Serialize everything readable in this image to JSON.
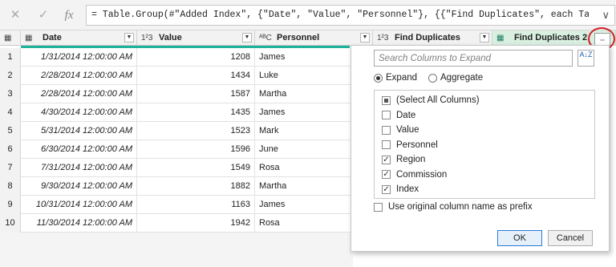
{
  "formula_bar": {
    "cancel_icon": "✕",
    "confirm_icon": "✓",
    "fx_label": "fx",
    "formula": "= Table.Group(#\"Added Index\", {\"Date\", \"Value\", \"Personnel\"}, {{\"Find Duplicates\", each Table.RowCount",
    "expand_icon": "chevron-down-icon"
  },
  "columns": [
    {
      "type_icon": "▦",
      "name": "Date"
    },
    {
      "type_icon": "1²3",
      "name": "Value"
    },
    {
      "type_icon": "ᴬᴮC",
      "name": "Personnel"
    },
    {
      "type_icon": "1²3",
      "name": "Find Duplicates"
    },
    {
      "type_icon": "▦",
      "name": "Find Duplicates 2"
    }
  ],
  "table_menu_icon": "▦",
  "rows": [
    {
      "n": "1",
      "date": "1/31/2014 12:00:00 AM",
      "value": "1208",
      "person": "James"
    },
    {
      "n": "2",
      "date": "2/28/2014 12:00:00 AM",
      "value": "1434",
      "person": "Luke"
    },
    {
      "n": "3",
      "date": "2/28/2014 12:00:00 AM",
      "value": "1587",
      "person": "Martha"
    },
    {
      "n": "4",
      "date": "4/30/2014 12:00:00 AM",
      "value": "1435",
      "person": "James"
    },
    {
      "n": "5",
      "date": "5/31/2014 12:00:00 AM",
      "value": "1523",
      "person": "Mark"
    },
    {
      "n": "6",
      "date": "6/30/2014 12:00:00 AM",
      "value": "1596",
      "person": "June"
    },
    {
      "n": "7",
      "date": "7/31/2014 12:00:00 AM",
      "value": "1549",
      "person": "Rosa"
    },
    {
      "n": "8",
      "date": "9/30/2014 12:00:00 AM",
      "value": "1882",
      "person": "Martha"
    },
    {
      "n": "9",
      "date": "10/31/2014 12:00:00 AM",
      "value": "1163",
      "person": "James"
    },
    {
      "n": "10",
      "date": "11/30/2014 12:00:00 AM",
      "value": "1942",
      "person": "Rosa"
    }
  ],
  "panel": {
    "search_placeholder": "Search Columns to Expand",
    "sort_icon": "A↓Z",
    "expand_label": "Expand",
    "aggregate_label": "Aggregate",
    "expand_selected": true,
    "items": [
      {
        "label": "(Select All Columns)",
        "state": "partial"
      },
      {
        "label": "Date",
        "state": "unchecked"
      },
      {
        "label": "Value",
        "state": "unchecked"
      },
      {
        "label": "Personnel",
        "state": "unchecked"
      },
      {
        "label": "Region",
        "state": "checked"
      },
      {
        "label": "Commission",
        "state": "checked"
      },
      {
        "label": "Index",
        "state": "checked"
      }
    ],
    "prefix_label": "Use original column name as prefix",
    "ok_label": "OK",
    "cancel_label": "Cancel"
  },
  "colors": {
    "accent_teal": "#1fb39b",
    "highlight_circle": "#d21f26",
    "table_header_green": "#d9efe0"
  }
}
